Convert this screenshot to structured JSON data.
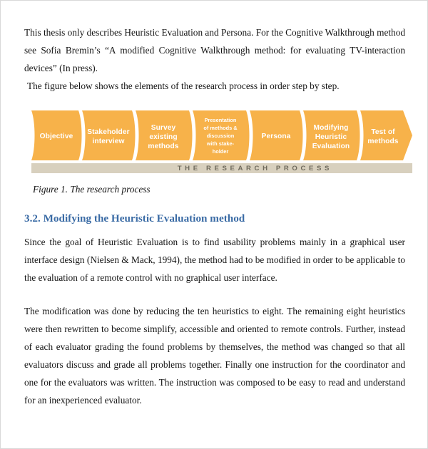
{
  "document": {
    "intro_paragraph": "This thesis only describes Heuristic Evaluation and Persona. For the Cognitive Walkthrough method see Sofia Bremin’s “A modified Cognitive Walkthrough method: for evaluating TV-interaction devices” (In press).",
    "intro_last_line": "The figure below shows the elements of the research process in order step by step.",
    "figure_caption": "Figure 1. The research process",
    "section_heading": "3.2. Modifying the Heuristic Evaluation method",
    "paragraph_1": "Since the goal of Heuristic Evaluation is to find usability problems mainly in a graphical user interface design (Nielsen & Mack, 1994), the method had to be modified in order to be applicable to the evaluation of a remote control with no graphical user interface.",
    "paragraph_2": "The modification was done by reducing the ten heuristics to eight. The remaining eight heuristics were then rewritten to become simplify, accessible and oriented to remote controls. Further, instead of each evaluator grading the found problems by themselves, the method was changed so that all evaluators discuss and grade all problems together. Finally one instruction for the coordinator and one for the evaluators was written. The instruction was composed to be easy to read and understand for an inexperienced evaluator."
  },
  "figure": {
    "banner_text": "THE RESEARCH PROCESS",
    "colors": {
      "chevron_fill": "#f6b košt",
      "chevron": "#f7b24a",
      "banner_bg": "#d8d0be",
      "banner_text": "#6f6a5c",
      "separator": "#ffffff",
      "heading_blue": "#3a6ba5"
    },
    "steps": [
      {
        "id": "objective",
        "lines": [
          "Objective"
        ],
        "size": "normal"
      },
      {
        "id": "stakeholder-interview",
        "lines": [
          "Stakeholder",
          "interview"
        ],
        "size": "normal"
      },
      {
        "id": "survey-existing-methods",
        "lines": [
          "Survey",
          "existing",
          "methods"
        ],
        "size": "normal"
      },
      {
        "id": "presentation-discussion",
        "lines": [
          "Presentation",
          "of methods &",
          "discussion",
          "with stake-",
          "holder"
        ],
        "size": "small"
      },
      {
        "id": "persona",
        "lines": [
          "Persona"
        ],
        "size": "normal"
      },
      {
        "id": "modifying-heuristic-evaluation",
        "lines": [
          "Modifying",
          "Heuristic",
          "Evaluation"
        ],
        "size": "normal"
      },
      {
        "id": "test-of-methods",
        "lines": [
          "Test of",
          "methods"
        ],
        "size": "normal"
      }
    ]
  }
}
